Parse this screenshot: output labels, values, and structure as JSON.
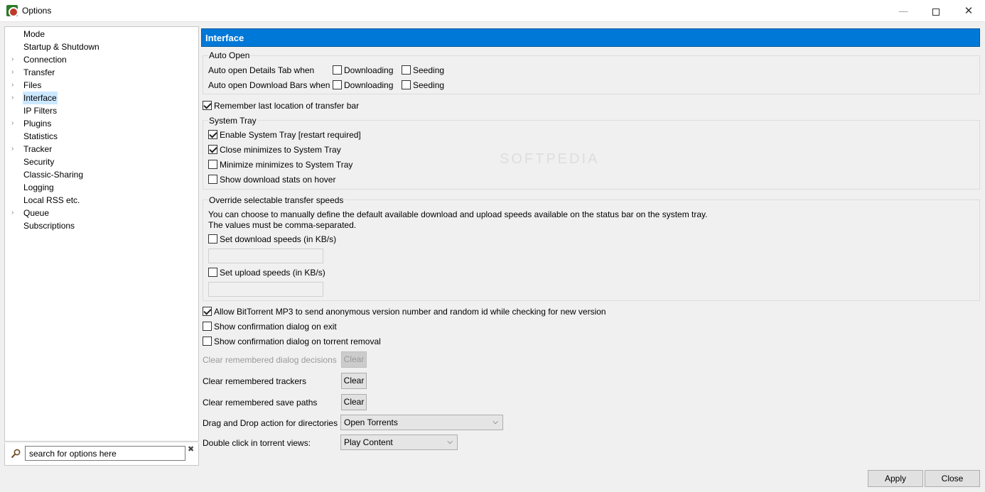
{
  "window": {
    "title": "Options",
    "minimize": "—",
    "close": "✕"
  },
  "sidebar": {
    "items": [
      {
        "label": "Mode",
        "arrow": ""
      },
      {
        "label": "Startup & Shutdown",
        "arrow": ""
      },
      {
        "label": "Connection",
        "arrow": "›"
      },
      {
        "label": "Transfer",
        "arrow": "›"
      },
      {
        "label": "Files",
        "arrow": "›"
      },
      {
        "label": "Interface",
        "arrow": "›"
      },
      {
        "label": "IP Filters",
        "arrow": ""
      },
      {
        "label": "Plugins",
        "arrow": "›"
      },
      {
        "label": "Statistics",
        "arrow": ""
      },
      {
        "label": "Tracker",
        "arrow": "›"
      },
      {
        "label": "Security",
        "arrow": ""
      },
      {
        "label": "Classic-Sharing",
        "arrow": ""
      },
      {
        "label": "Logging",
        "arrow": ""
      },
      {
        "label": "Local RSS etc.",
        "arrow": ""
      },
      {
        "label": "Queue",
        "arrow": "›"
      },
      {
        "label": "Subscriptions",
        "arrow": ""
      }
    ],
    "selected": "Interface"
  },
  "search": {
    "value": "search for options here",
    "clear_icon": "✖"
  },
  "panel": {
    "header": "Interface",
    "auto_open": {
      "title": "Auto Open",
      "details_label": "Auto open Details Tab when",
      "bars_label": "Auto open Download Bars when",
      "downloading": "Downloading",
      "seeding": "Seeding"
    },
    "remember_location": "Remember last location of transfer bar",
    "system_tray": {
      "title": "System Tray",
      "enable": "Enable System Tray [restart required]",
      "close_min": "Close minimizes to System Tray",
      "min_min": "Minimize minimizes to System Tray",
      "stats_hover": "Show download stats on hover"
    },
    "speeds": {
      "title": "Override selectable transfer speeds",
      "desc1": "You can choose to manually define the default available download and upload speeds available on the status bar on the system tray.",
      "desc2": "The values must be comma-separated.",
      "download": "Set download speeds (in KB/s)",
      "upload": "Set upload speeds (in KB/s)"
    },
    "allow_mp3": "Allow BitTorrent MP3 to send anonymous version number and random id while checking for new version",
    "confirm_exit": "Show confirmation dialog on exit",
    "confirm_removal": "Show confirmation dialog on torrent removal",
    "clear_dialog": "Clear remembered dialog decisions",
    "clear_trackers": "Clear remembered trackers",
    "clear_paths": "Clear remembered save paths",
    "clear_btn": "Clear",
    "dnd_label": "Drag and Drop action for directories",
    "dnd_value": "Open Torrents",
    "dblclick_label": "Double click in torrent views:",
    "dblclick_value": "Play Content",
    "chevron": "⌵"
  },
  "footer": {
    "apply": "Apply",
    "close": "Close"
  },
  "watermark": "SOFTPEDIA"
}
